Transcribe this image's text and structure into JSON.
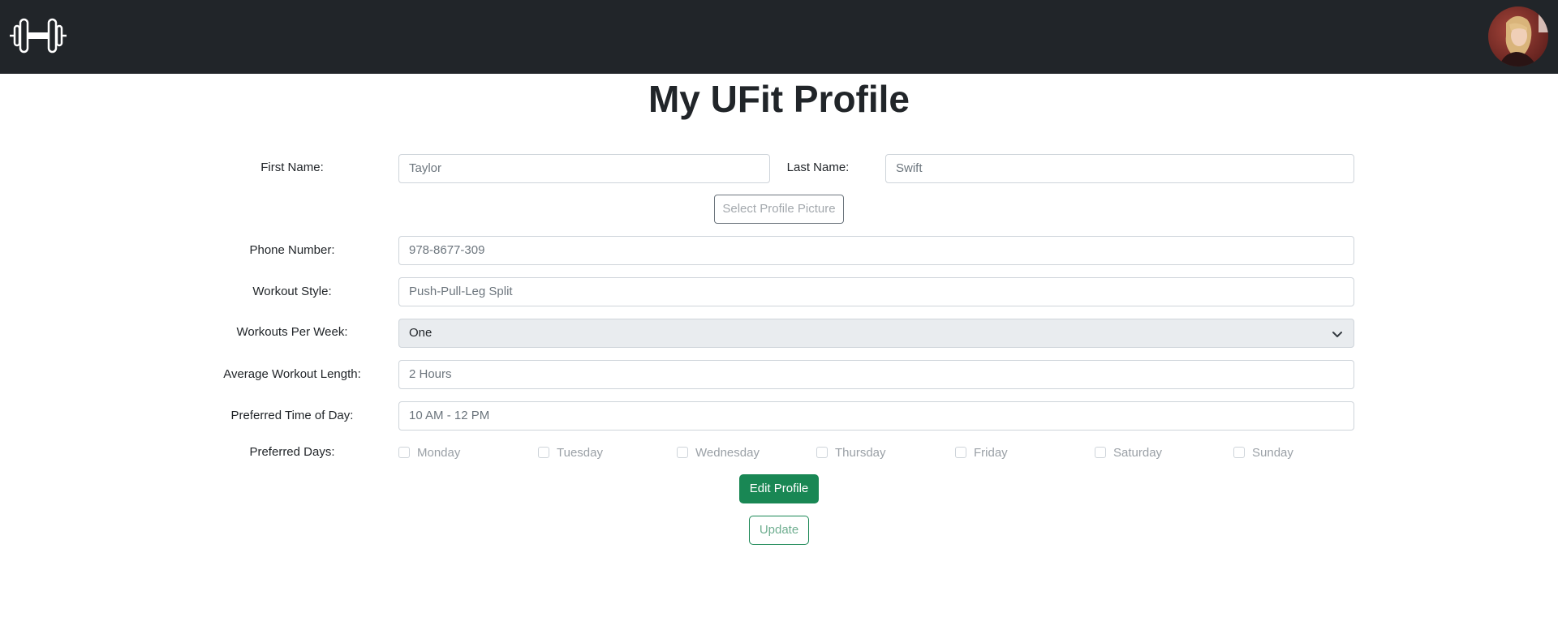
{
  "page": {
    "title": "My UFit Profile"
  },
  "navbar": {
    "logo_icon": "dumbbell-icon",
    "avatar_icon": "user-avatar"
  },
  "form": {
    "first_name": {
      "label": "First Name:",
      "value": "Taylor"
    },
    "last_name": {
      "label": "Last Name:",
      "value": "Swift"
    },
    "select_picture_label": "Select Profile Picture",
    "phone": {
      "label": "Phone Number:",
      "value": "978-8677-309"
    },
    "workout_style": {
      "label": "Workout Style:",
      "value": "Push-Pull-Leg Split"
    },
    "workouts_per_week": {
      "label": "Workouts Per Week:",
      "value": "One"
    },
    "avg_length": {
      "label": "Average Workout Length:",
      "value": "2 Hours"
    },
    "preferred_time": {
      "label": "Preferred Time of Day:",
      "value": "10 AM - 12 PM"
    },
    "preferred_days": {
      "label": "Preferred Days:",
      "days": [
        {
          "name": "Monday",
          "checked": false
        },
        {
          "name": "Tuesday",
          "checked": false
        },
        {
          "name": "Wednesday",
          "checked": false
        },
        {
          "name": "Thursday",
          "checked": false
        },
        {
          "name": "Friday",
          "checked": false
        },
        {
          "name": "Saturday",
          "checked": false
        },
        {
          "name": "Sunday",
          "checked": false
        }
      ]
    },
    "edit_button_label": "Edit Profile",
    "update_button_label": "Update"
  },
  "colors": {
    "navbar_bg": "#212529",
    "primary_green": "#198754",
    "border": "#ced4da",
    "disabled_bg": "#e9ecef"
  }
}
